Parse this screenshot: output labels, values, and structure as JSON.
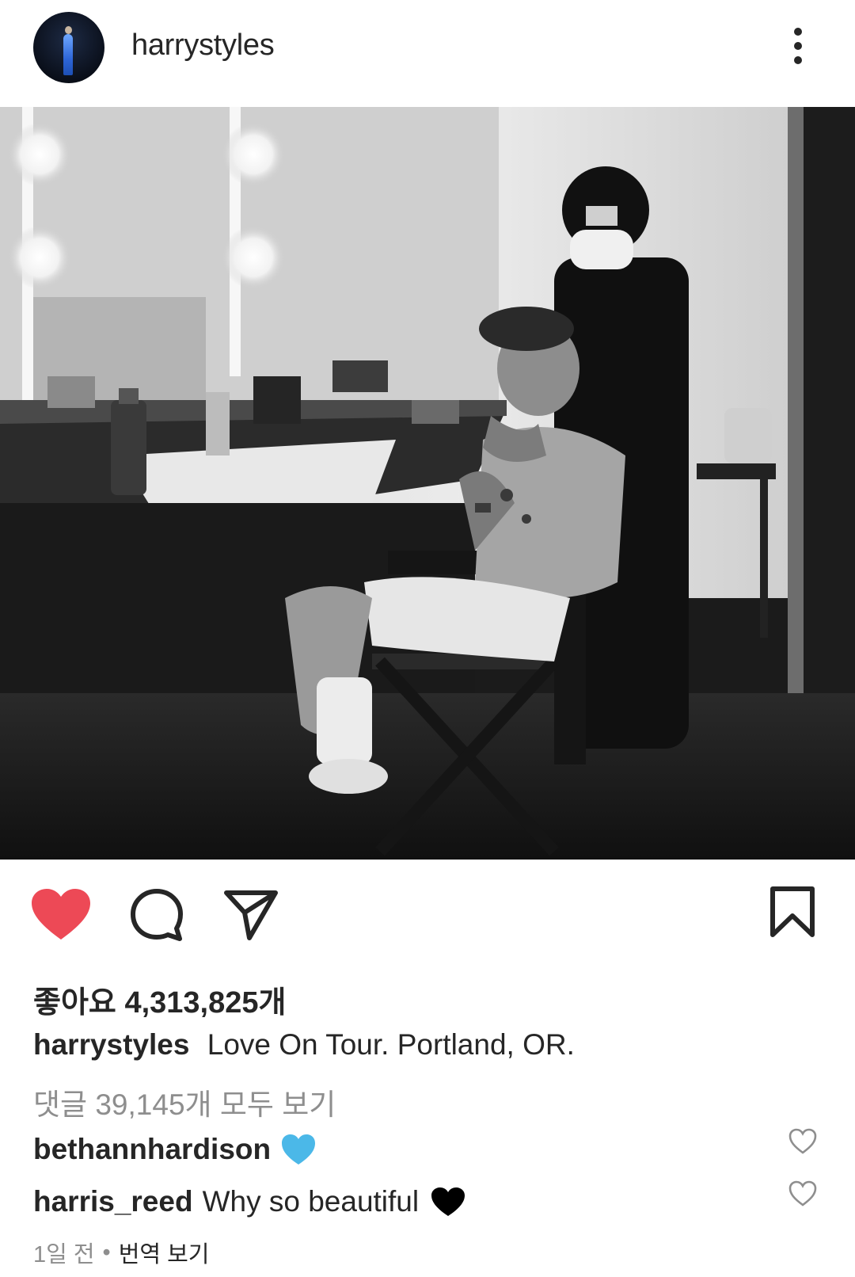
{
  "post": {
    "username": "harrystyles",
    "avatar_icon": "profile-avatar",
    "more_icon": "more-vertical-icon"
  },
  "photo": {
    "description_icon": "post-photo"
  },
  "actions": {
    "like_icon": "heart-filled-icon",
    "like_color": "#ed4956",
    "comment_icon": "comment-bubble-icon",
    "share_icon": "paper-plane-icon",
    "save_icon": "bookmark-icon"
  },
  "likes_text": "좋아요 4,313,825개",
  "caption": {
    "username": "harrystyles",
    "text": "Love On Tour. Portland, OR."
  },
  "view_comments": "댓글 39,145개 모두 보기",
  "comments": [
    {
      "username": "bethannhardison",
      "text": "",
      "emoji_icon": "blue-heart-icon",
      "emoji_color": "#4bb8e8"
    },
    {
      "username": "harris_reed",
      "text": "Why so beautiful",
      "emoji_icon": "black-heart-icon",
      "emoji_color": "#000000"
    }
  ],
  "meta": {
    "time": "1일 전",
    "separator": "•",
    "translate": "번역 보기"
  }
}
